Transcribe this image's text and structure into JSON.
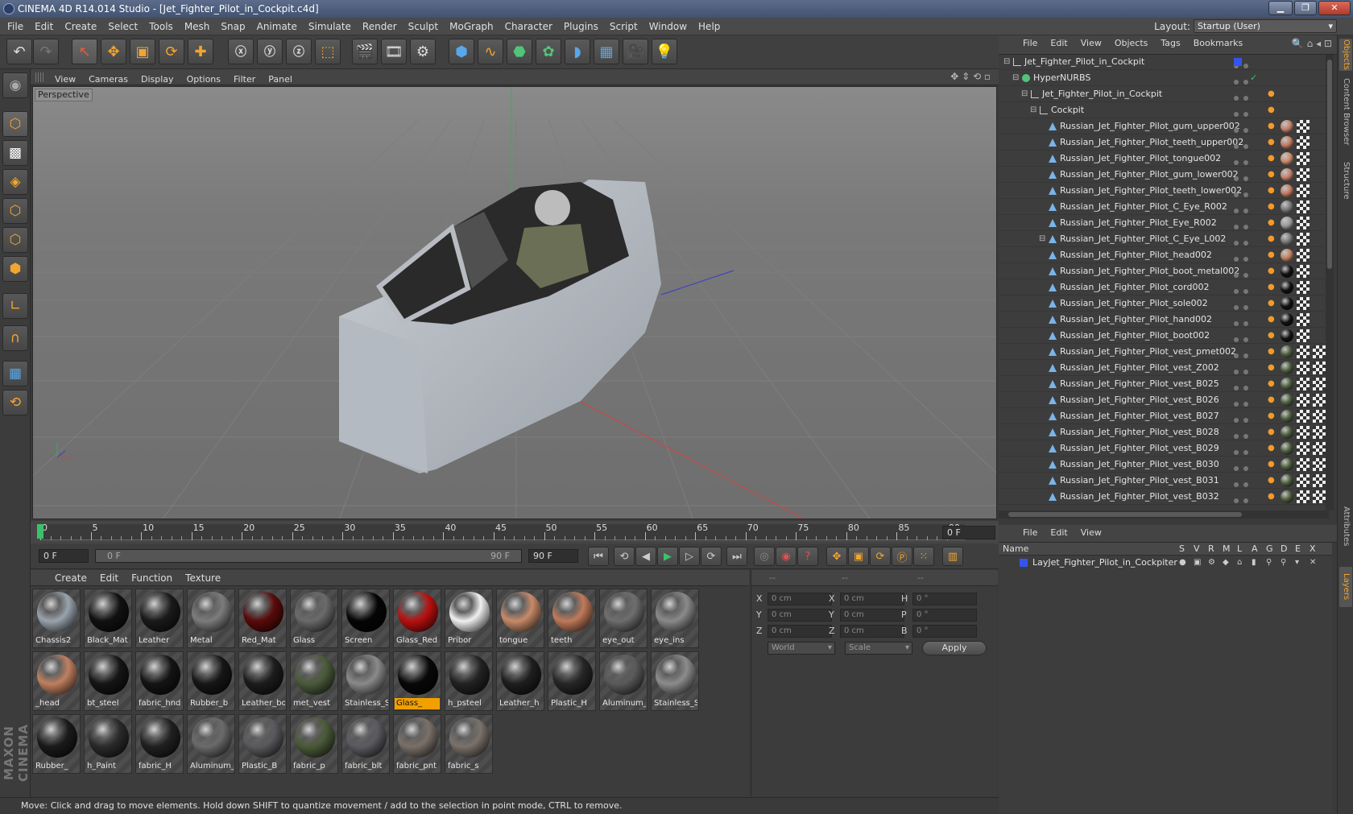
{
  "window": {
    "title": "CINEMA 4D R14.014 Studio - [Jet_Fighter_Pilot_in_Cockpit.c4d]",
    "min": "▁",
    "max": "❐",
    "close": "✕"
  },
  "menu": [
    "File",
    "Edit",
    "Create",
    "Select",
    "Tools",
    "Mesh",
    "Snap",
    "Animate",
    "Simulate",
    "Render",
    "Sculpt",
    "MoGraph",
    "Character",
    "Plugins",
    "Script",
    "Window",
    "Help"
  ],
  "layout": {
    "label": "Layout:",
    "value": "Startup (User)"
  },
  "viewport": {
    "menu": [
      "View",
      "Cameras",
      "Display",
      "Options",
      "Filter",
      "Panel"
    ],
    "label": "Perspective"
  },
  "timeline": {
    "ticks": [
      "0",
      "5",
      "10",
      "15",
      "20",
      "25",
      "30",
      "35",
      "40",
      "45",
      "50",
      "55",
      "60",
      "65",
      "70",
      "75",
      "80",
      "85",
      "90"
    ],
    "frame_field": "0 F",
    "start": "0 F",
    "range_start": "0 F",
    "range_end": "90 F",
    "end": "90 F"
  },
  "materials": {
    "menu": [
      "Create",
      "Edit",
      "Function",
      "Texture"
    ],
    "items": [
      {
        "name": "Chassis2",
        "color": "#9aa3ad"
      },
      {
        "name": "Black_Mat",
        "color": "#111111"
      },
      {
        "name": "Leather",
        "color": "#1a1a1a"
      },
      {
        "name": "Metal",
        "color": "#7c7c7c"
      },
      {
        "name": "Red_Mat",
        "color": "#5a0a0a"
      },
      {
        "name": "Glass",
        "color": "#6a6a6a"
      },
      {
        "name": "Screen",
        "color": "#050505"
      },
      {
        "name": "Glass_Red",
        "color": "#b81010"
      },
      {
        "name": "Pribor",
        "color": "#f0f0f0"
      },
      {
        "name": "tongue",
        "color": "#c88a6a"
      },
      {
        "name": "teeth",
        "color": "#c07a5a"
      },
      {
        "name": "eye_out",
        "color": "#6e6e6e"
      },
      {
        "name": "eye_ins",
        "color": "#8a8a8a"
      },
      {
        "name": "_head",
        "color": "#c08060"
      },
      {
        "name": "bt_steel",
        "color": "#151515"
      },
      {
        "name": "fabric_hnd",
        "color": "#141414"
      },
      {
        "name": "Rubber_b",
        "color": "#161616"
      },
      {
        "name": "Leather_bo",
        "color": "#1c1c1c"
      },
      {
        "name": "met_vest",
        "color": "#4a5a3a"
      },
      {
        "name": "Stainless_S",
        "color": "#8a8a8a"
      },
      {
        "name": "Glass_",
        "color": "#080808"
      },
      {
        "name": "h_psteel",
        "color": "#222222"
      },
      {
        "name": "Leather_h",
        "color": "#1e1e1e"
      },
      {
        "name": "Plastic_H",
        "color": "#262626"
      },
      {
        "name": "Aluminum_",
        "color": "#5a5a5a"
      },
      {
        "name": "Stainless_S",
        "color": "#8c8c8c"
      },
      {
        "name": "Rubber_",
        "color": "#1a1a1a"
      },
      {
        "name": "h_Paint",
        "color": "#2a2a2a"
      },
      {
        "name": "fabric_H",
        "color": "#202020"
      },
      {
        "name": "Aluminum_",
        "color": "#6a6a6a"
      },
      {
        "name": "Plastic_B",
        "color": "#5a5a5e"
      },
      {
        "name": "fabric_p",
        "color": "#4a5a38"
      },
      {
        "name": "fabric_blt",
        "color": "#5a5a60"
      },
      {
        "name": "fabric_pnt",
        "color": "#7a7068"
      },
      {
        "name": "fabric_s",
        "color": "#7a726a"
      }
    ],
    "selected_index": 20
  },
  "coords": {
    "header": [
      "--",
      "--",
      "--"
    ],
    "rows": [
      {
        "a": "X",
        "av": "0 cm",
        "b": "X",
        "bv": "0 cm",
        "c": "H",
        "cv": "0 °"
      },
      {
        "a": "Y",
        "av": "0 cm",
        "b": "Y",
        "bv": "0 cm",
        "c": "P",
        "cv": "0 °"
      },
      {
        "a": "Z",
        "av": "0 cm",
        "b": "Z",
        "bv": "0 cm",
        "c": "B",
        "cv": "0 °"
      }
    ],
    "mode": "World",
    "scale": "Scale",
    "apply": "Apply"
  },
  "status": "Move: Click and drag to move elements. Hold down SHIFT to quantize movement / add to the selection in point mode, CTRL to remove.",
  "objects": {
    "menu": [
      "File",
      "Edit",
      "View",
      "Objects",
      "Tags",
      "Bookmarks"
    ],
    "rows": [
      {
        "name": "Jet_Fighter_Pilot_in_Cockpit",
        "indent": 0,
        "type": "null",
        "tags": "layer",
        "sphere": ""
      },
      {
        "name": "HyperNURBS",
        "indent": 1,
        "type": "nurbs",
        "tags": "check",
        "sphere": ""
      },
      {
        "name": "Jet_Fighter_Pilot_in_Cockpit",
        "indent": 2,
        "type": "null",
        "tags": "phong",
        "sphere": ""
      },
      {
        "name": "Cockpit",
        "indent": 3,
        "type": "null",
        "tags": "phong",
        "sphere": ""
      },
      {
        "name": "Russian_Jet_Fighter_Pilot_gum_upper002",
        "indent": 4,
        "type": "poly",
        "tags": "full",
        "sphere": "#c0806a"
      },
      {
        "name": "Russian_Jet_Fighter_Pilot_teeth_upper002",
        "indent": 4,
        "type": "poly",
        "tags": "full",
        "sphere": "#c07a60"
      },
      {
        "name": "Russian_Jet_Fighter_Pilot_tongue002",
        "indent": 4,
        "type": "poly",
        "tags": "full",
        "sphere": "#c88a6a"
      },
      {
        "name": "Russian_Jet_Fighter_Pilot_gum_lower002",
        "indent": 4,
        "type": "poly",
        "tags": "full",
        "sphere": "#c0806a"
      },
      {
        "name": "Russian_Jet_Fighter_Pilot_teeth_lower002",
        "indent": 4,
        "type": "poly",
        "tags": "full",
        "sphere": "#c07a60"
      },
      {
        "name": "Russian_Jet_Fighter_Pilot_C_Eye_R002",
        "indent": 4,
        "type": "poly",
        "tags": "full",
        "sphere": "#777777"
      },
      {
        "name": "Russian_Jet_Fighter_Pilot_Eye_R002",
        "indent": 4,
        "type": "poly",
        "tags": "full",
        "sphere": "#999999"
      },
      {
        "name": "Russian_Jet_Fighter_Pilot_C_Eye_L002",
        "indent": 4,
        "type": "poly",
        "tags": "full",
        "sphere": "#777777"
      },
      {
        "name": "Russian_Jet_Fighter_Pilot_head002",
        "indent": 4,
        "type": "poly",
        "tags": "full",
        "sphere": "#c08060"
      },
      {
        "name": "Russian_Jet_Fighter_Pilot_boot_metal002",
        "indent": 4,
        "type": "poly",
        "tags": "full",
        "sphere": "#111111"
      },
      {
        "name": "Russian_Jet_Fighter_Pilot_cord002",
        "indent": 4,
        "type": "poly",
        "tags": "full",
        "sphere": "#111111"
      },
      {
        "name": "Russian_Jet_Fighter_Pilot_sole002",
        "indent": 4,
        "type": "poly",
        "tags": "full",
        "sphere": "#111111"
      },
      {
        "name": "Russian_Jet_Fighter_Pilot_hand002",
        "indent": 4,
        "type": "poly",
        "tags": "full",
        "sphere": "#111111"
      },
      {
        "name": "Russian_Jet_Fighter_Pilot_boot002",
        "indent": 4,
        "type": "poly",
        "tags": "full",
        "sphere": "#111111"
      },
      {
        "name": "Russian_Jet_Fighter_Pilot_vest_pmet002",
        "indent": 4,
        "type": "poly",
        "tags": "full2",
        "sphere": "#4a5a3a"
      },
      {
        "name": "Russian_Jet_Fighter_Pilot_vest_Z002",
        "indent": 4,
        "type": "poly",
        "tags": "full2",
        "sphere": "#4a5a3a"
      },
      {
        "name": "Russian_Jet_Fighter_Pilot_vest_B025",
        "indent": 4,
        "type": "poly",
        "tags": "full2",
        "sphere": "#4a5a3a"
      },
      {
        "name": "Russian_Jet_Fighter_Pilot_vest_B026",
        "indent": 4,
        "type": "poly",
        "tags": "full2",
        "sphere": "#4a5a3a"
      },
      {
        "name": "Russian_Jet_Fighter_Pilot_vest_B027",
        "indent": 4,
        "type": "poly",
        "tags": "full2",
        "sphere": "#4a5a3a"
      },
      {
        "name": "Russian_Jet_Fighter_Pilot_vest_B028",
        "indent": 4,
        "type": "poly",
        "tags": "full2",
        "sphere": "#4a5a3a"
      },
      {
        "name": "Russian_Jet_Fighter_Pilot_vest_B029",
        "indent": 4,
        "type": "poly",
        "tags": "full2",
        "sphere": "#4a5a3a"
      },
      {
        "name": "Russian_Jet_Fighter_Pilot_vest_B030",
        "indent": 4,
        "type": "poly",
        "tags": "full2",
        "sphere": "#4a5a3a"
      },
      {
        "name": "Russian_Jet_Fighter_Pilot_vest_B031",
        "indent": 4,
        "type": "poly",
        "tags": "full2",
        "sphere": "#4a5a3a"
      },
      {
        "name": "Russian_Jet_Fighter_Pilot_vest_B032",
        "indent": 4,
        "type": "poly",
        "tags": "full2",
        "sphere": "#4a5a3a"
      }
    ]
  },
  "layers": {
    "menu": [
      "File",
      "Edit",
      "View"
    ],
    "columns": [
      "Name",
      "S",
      "V",
      "R",
      "M",
      "L",
      "A",
      "G",
      "D",
      "E",
      "X"
    ],
    "rows": [
      {
        "name": "LayJet_Fighter_Pilot_in_Cockpiter",
        "color": "#3355ee"
      }
    ]
  },
  "side_tabs": [
    "Objects",
    "Content Browser",
    "Structure",
    "Attributes",
    "Layers"
  ]
}
